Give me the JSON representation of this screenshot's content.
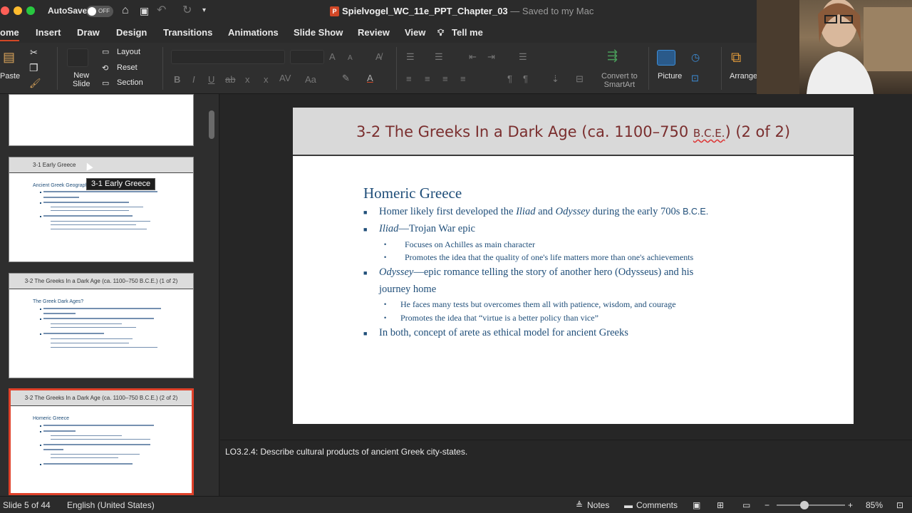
{
  "titlebar": {
    "autosave_label": "AutoSave",
    "autosave_state": "OFF",
    "document_name": "Spielvogel_WC_11e_PPT_Chapter_03",
    "save_status": "— Saved to my Mac"
  },
  "tabs": [
    "ome",
    "Insert",
    "Draw",
    "Design",
    "Transitions",
    "Animations",
    "Slide Show",
    "Review",
    "View",
    "Tell me"
  ],
  "ribbon": {
    "paste_label": "Paste",
    "new_slide_label": "New\nSlide",
    "layout_label": "Layout",
    "reset_label": "Reset",
    "section_label": "Section",
    "convert_label": "Convert to\nSmartArt",
    "picture_label": "Picture",
    "arrange_label": "Arrange"
  },
  "thumbnails": [
    {
      "title": "3-1 Early Greece",
      "heading": "Ancient Greek Geography"
    },
    {
      "title": "3-2 The Greeks In a Dark Age (ca. 1100–750 B.C.E.) (1 of 2)",
      "heading": "The Greek Dark Ages?"
    },
    {
      "title": "3-2 The Greeks In a Dark Age (ca. 1100–750 B.C.E.) (2 of 2)",
      "heading": "Homeric Greece"
    }
  ],
  "tooltip": "3-1 Early Greece",
  "slide": {
    "title_main": "3-2 The Greeks In a Dark Age (ca. 1100–750 ",
    "title_bce": "B.C.E.",
    "title_end": ") (2 of 2)",
    "heading": "Homeric Greece",
    "b1_pre": "Homer likely first developed the ",
    "b1_iliad": "Iliad",
    "b1_and": " and ",
    "b1_odyssey": "Odyssey",
    "b1_post": " during the early 700s ",
    "b1_bce": "B.C.E.",
    "b2_iliad": "Iliad",
    "b2_rest": "—Trojan War epic",
    "b2_sub1": "Focuses on Achilles as main character",
    "b2_sub2": "Promotes the idea that the quality of one's life matters more than one's achievements",
    "b3_odyssey": "Odyssey",
    "b3_rest": "—epic romance telling the story of another hero (Odysseus) and his",
    "b3_rest2": "journey home",
    "b3_sub1": "He faces many tests but overcomes them all with patience, wisdom, and courage",
    "b3_sub2": "Promotes the idea that “virtue is a better policy than vice”",
    "b4": "In both, concept of arete as ethical model for ancient Greeks"
  },
  "notes": "LO3.2.4: Describe cultural products of ancient Greek city-states.",
  "status": {
    "slide_counter": "Slide 5 of 44",
    "language": "English (United States)",
    "notes_label": "Notes",
    "comments_label": "Comments",
    "zoom": "85%"
  },
  "colors": {
    "accent": "#d24726",
    "title": "#7a2e2e",
    "body": "#1f4e79",
    "selected_thumb": "#e0412a"
  }
}
